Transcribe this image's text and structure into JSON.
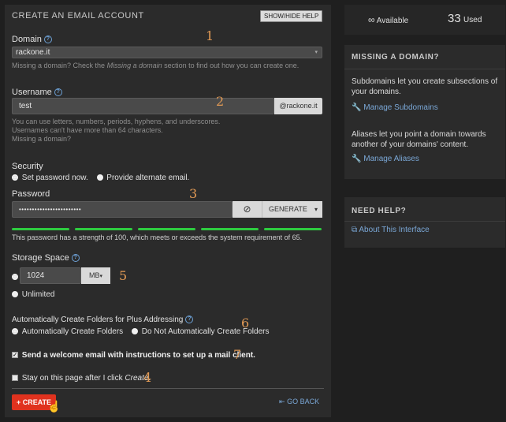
{
  "header": {
    "title": "CREATE AN EMAIL ACCOUNT",
    "toggle_help": "SHOW/HIDE HELP"
  },
  "domain": {
    "label": "Domain",
    "value": "rackone.it",
    "help_prefix": "Missing a domain? Check the ",
    "help_em": "Missing a domain",
    "help_suffix": " section to find out how you can create one."
  },
  "username": {
    "label": "Username",
    "value": "test",
    "suffix": "@rackone.it",
    "help1": "You can use letters, numbers, periods, hyphens, and underscores.",
    "help2": "Usernames can't have more than 64 characters.",
    "help3": "Missing a domain?"
  },
  "security": {
    "label": "Security",
    "opt1": "Set password now.",
    "opt2": "Provide alternate email."
  },
  "password": {
    "label": "Password",
    "value": "••••••••••••••••••••••••",
    "generate": "GENERATE",
    "strength_text": "This password has a strength of 100, which meets or exceeds the system requirement of 65.",
    "strength": 100
  },
  "storage": {
    "label": "Storage Space",
    "value": "1024",
    "unit": "MB",
    "unlimited": "Unlimited"
  },
  "folders": {
    "label": "Automatically Create Folders for Plus Addressing",
    "opt1": "Automatically Create Folders",
    "opt2": "Do Not Automatically Create Folders"
  },
  "welcome": {
    "label": "Send a welcome email with instructions to set up a mail client."
  },
  "stay": {
    "prefix": "Stay on this page after I click ",
    "em": "Create",
    "suffix": "."
  },
  "actions": {
    "create": "CREATE",
    "go_back": "GO BACK"
  },
  "stats": {
    "available_symbol": "∞",
    "available_label": "Available",
    "used_count": "33",
    "used_label": "Used"
  },
  "missing": {
    "title": "MISSING A DOMAIN?",
    "sub_text": "Subdomains let you create subsections of your domains.",
    "sub_link": "Manage Subdomains",
    "alias_text": "Aliases let you point a domain towards another of your domains' content.",
    "alias_link": "Manage Aliases"
  },
  "help": {
    "title": "NEED HELP?",
    "link": "About This Interface"
  },
  "annotations": [
    "1",
    "2",
    "3",
    "4",
    "5",
    "6",
    "7"
  ],
  "colors": {
    "accent": "#e0321e",
    "strength": "#2ecc40",
    "link": "#7aa7d6",
    "annotation": "#e29a55"
  }
}
